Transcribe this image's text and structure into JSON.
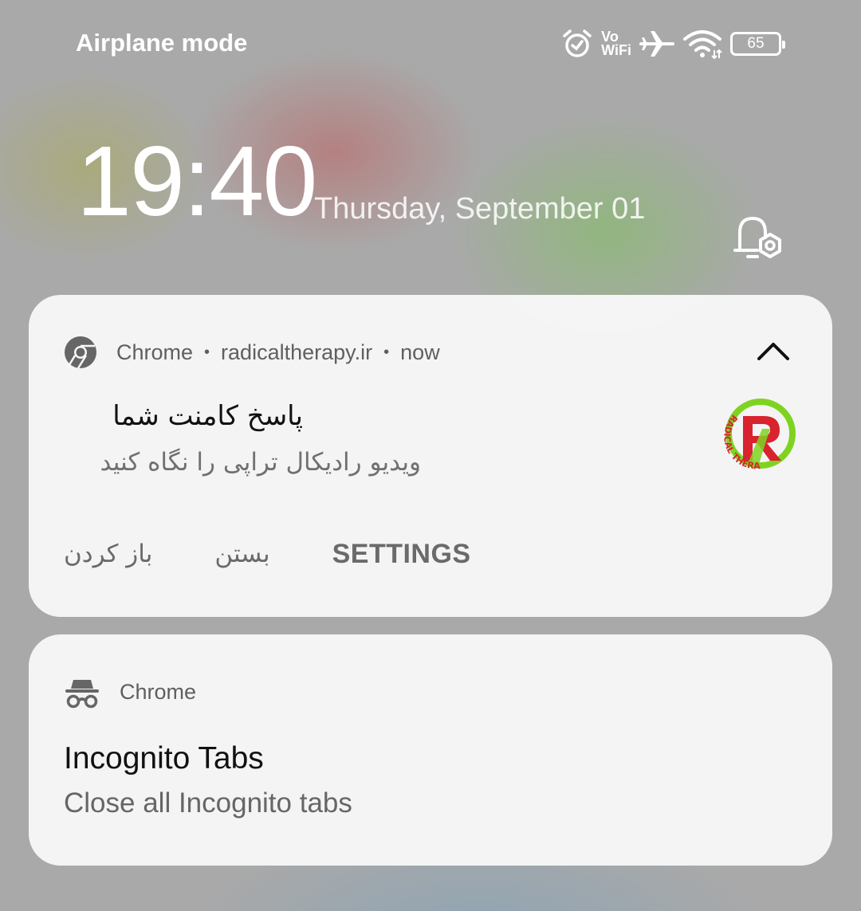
{
  "status_bar": {
    "carrier": "Airplane mode",
    "icons": [
      "alarm-icon",
      "vowifi-icon",
      "airplane-icon",
      "wifi-icon",
      "battery-icon"
    ],
    "vowifi_top": "Vo",
    "vowifi_bottom": "WiFi",
    "battery_level": "65"
  },
  "lockscreen": {
    "time": "19:40",
    "date": "Thursday, September 01",
    "notification_settings_icon": "bell-gear-icon"
  },
  "notifications": [
    {
      "app": "Chrome",
      "source": "radicaltherapy.ir",
      "time": "now",
      "title": "پاسخ کامنت شما",
      "body": "ویدیو رادیکال تراپی را نگاه کنید",
      "actions": [
        "باز کردن",
        "بستن",
        "SETTINGS"
      ],
      "icon": "chrome-icon",
      "logo_text": "RADICAL THERAPY"
    },
    {
      "app": "Chrome",
      "title": "Incognito Tabs",
      "body": "Close all Incognito tabs",
      "icon": "incognito-icon"
    }
  ],
  "colors": {
    "card_bg": "#f7f7f7",
    "logo_red": "#d9232e",
    "logo_green": "#7ed321"
  }
}
